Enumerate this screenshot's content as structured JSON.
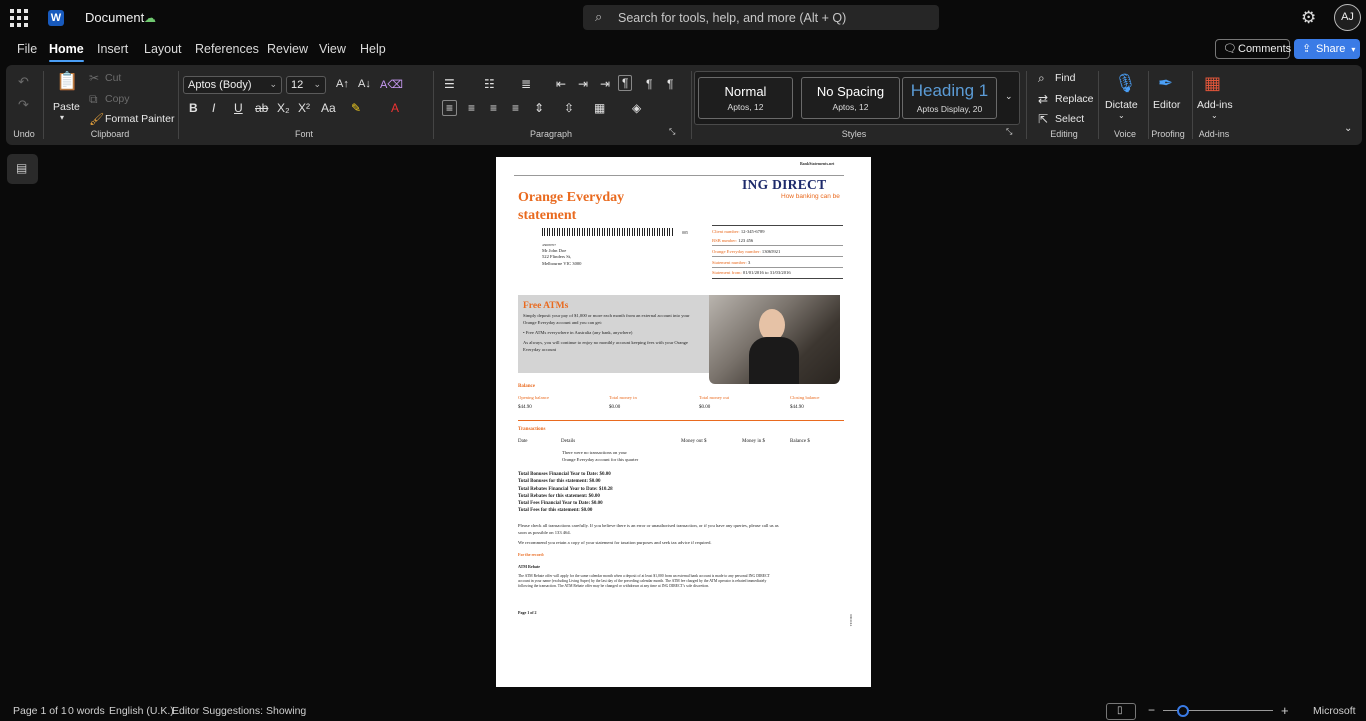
{
  "titlebar": {
    "doc_title": "Document",
    "saved_icon": "cloud-check-icon",
    "search_placeholder": "Search for tools, help, and more (Alt + Q)",
    "avatar_initials": "AJ"
  },
  "menu": {
    "tabs": [
      "File",
      "Home",
      "Insert",
      "Layout",
      "References",
      "Review",
      "View",
      "Help"
    ],
    "active": "Home",
    "comments_label": "Comments",
    "share_label": "Share"
  },
  "ribbon": {
    "undo": {
      "group_label": "Undo"
    },
    "clipboard": {
      "paste": "Paste",
      "cut": "Cut",
      "copy": "Copy",
      "format_painter": "Format Painter",
      "group_label": "Clipboard"
    },
    "font": {
      "font_name": "Aptos (Body)",
      "font_size": "12",
      "group_label": "Font"
    },
    "paragraph": {
      "group_label": "Paragraph"
    },
    "styles": {
      "items": [
        {
          "name": "Normal",
          "sub": "Aptos, 12"
        },
        {
          "name": "No Spacing",
          "sub": "Aptos, 12"
        },
        {
          "name": "Heading 1",
          "sub": "Aptos Display, 20"
        }
      ],
      "group_label": "Styles"
    },
    "editing": {
      "find": "Find",
      "replace": "Replace",
      "select": "Select",
      "group_label": "Editing"
    },
    "voice": {
      "dictate": "Dictate",
      "group_label": "Voice"
    },
    "proofing": {
      "editor": "Editor",
      "group_label": "Proofing"
    },
    "addins": {
      "addins": "Add-ins",
      "group_label": "Add-ins"
    }
  },
  "document": {
    "watermark": "BankStatements.net",
    "bank_name": "ING DIRECT",
    "bank_tagline": "How banking can be",
    "title_line1": "Orange Everyday",
    "title_line2": "statement",
    "barcode_suffix": "005",
    "address_code": "43008707",
    "address": [
      "Mr John Doe",
      "522 Flinders St,",
      "Melbourne VIC 3000"
    ],
    "details": [
      {
        "label": "Client number:",
        "value": "12-345-6789"
      },
      {
        "label": "BSB number:",
        "value": "123 456"
      },
      {
        "label": "Orange Everyday number:",
        "value": "13065921"
      },
      {
        "label": "Statement number:",
        "value": "3"
      },
      {
        "label": "Statement from:",
        "value": "01/01/2016 to 31/03/2016"
      }
    ],
    "promo": {
      "heading": "Free ATMs",
      "text1": "Simply deposit your pay of $1,000 or more each month from an external account into your Orange Everyday account and you can get:",
      "bullet": "Free ATMs everywhere in Australia (any bank, anywhere)",
      "text2": "As always, you will continue to enjoy no monthly account keeping fees with your Orange Everyday account"
    },
    "balance": {
      "heading": "Balance",
      "columns": [
        "Opening balance",
        "Total money in",
        "Total money out",
        "Closing balance"
      ],
      "values": [
        "$44.90",
        "$0.00",
        "$0.00",
        "$44.90"
      ]
    },
    "transactions": {
      "heading": "Transactions",
      "columns": [
        "Date",
        "Details",
        "Money out $",
        "Money in $",
        "Balance $"
      ],
      "empty_line1": "There were no transactions on your",
      "empty_line2": "Orange Everyday account for this quarter"
    },
    "totals": [
      "Total Bonuses Financial Year to Date: $0.00",
      "Total Bonuses for this statement: $0.00",
      "Total Rebates Financial Year to Date: $10.28",
      "Total Rebates for this statement: $0.00",
      "Total Fees Financial Year to Date: $0.00",
      "Total Fees for this statement: $0.00"
    ],
    "notice1_line1": "Please check all transactions carefully. If you believe there is an error or unauthorised transaction, or if you have any queries, please call us as",
    "notice1_line2": "soon as possible on 133 464.",
    "notice2": "We recommend you retain a copy of your statement for taxation purposes and seek tax advice if required.",
    "for_the_record": "For the record:",
    "atm_rebate_heading": "ATM Rebate",
    "atm_rebate_lines": [
      "The ATM Rebate offer will apply for the same calendar month when a deposit of at least $1,000 from an external bank account is made to any personal ING DIRECT",
      "account in your name (excluding Living Super) by the last day of the preceding calendar month. The ATM fee charged by the ATM operator is rebated immediately",
      "following the transaction. The ATM Rebate offer may be changed or withdrawn at any time at ING DIRECT's sole discretion."
    ],
    "page_footer": "Page 1 of 2",
    "side_code": "0003114"
  },
  "statusbar": {
    "page": "Page 1 of 1",
    "words": "0 words",
    "language": "English (U.K.)",
    "editor": "Editor Suggestions: Showing",
    "zoom_minus": "−",
    "zoom_plus": "+",
    "brand": "Microsoft"
  },
  "colors": {
    "accent": "#3a7be6",
    "ing_orange": "#e96a1f",
    "ing_navy": "#1d2a6b"
  }
}
